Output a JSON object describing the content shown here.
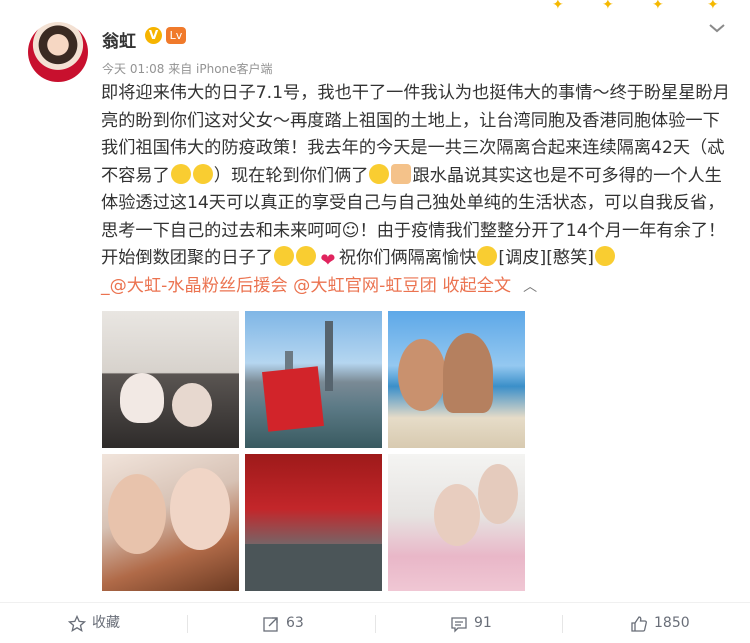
{
  "post": {
    "author": "翁虹",
    "verified_badge": "V",
    "level_badge": "Lv",
    "meta": "今天 01:08 来自 iPhone客户端",
    "text_parts": {
      "p1": "即将迎来伟大的日子7.1号，我也干了一件我认为也挺伟大的事情～终于盼星星盼月亮的盼到你们这对父女～再度踏上祖国的土地上，让台湾同胞及香港同胞体验一下我们祖国伟大的防疫政策！我去年的今天是一共三次隔离合起来连续隔离42天（忒不容易了",
      "p2": "）现在轮到你们俩了",
      "p3": "跟水晶说其实这也是不可多得的一个人生体验透过这14天可以真正的享受自己与自己独处单纯的生活状态，可以自我反省，思考一下自己的过去和未来呵呵☺！由于疫情我们整整分开了14个月一年有余了！开始倒数团聚的日子了",
      "p4": "祝你们俩隔离愉快",
      "tags": "[调皮][憨笑]",
      "mention1": "_@大虹-水晶粉丝后援会",
      "mention2": "@大虹官网-虹豆团",
      "collapse": "收起全文",
      "heart": "❤"
    },
    "icons": {
      "collapse": "chevron-up-icon",
      "more": "chevron-down-icon"
    }
  },
  "toolbar": {
    "favorite_label": "收藏",
    "repost_count": "63",
    "comment_count": "91",
    "like_count": "1850"
  },
  "colors": {
    "link": "#eb7350",
    "badge_v": "#f6b400",
    "badge_lv": "#f07a2b"
  }
}
